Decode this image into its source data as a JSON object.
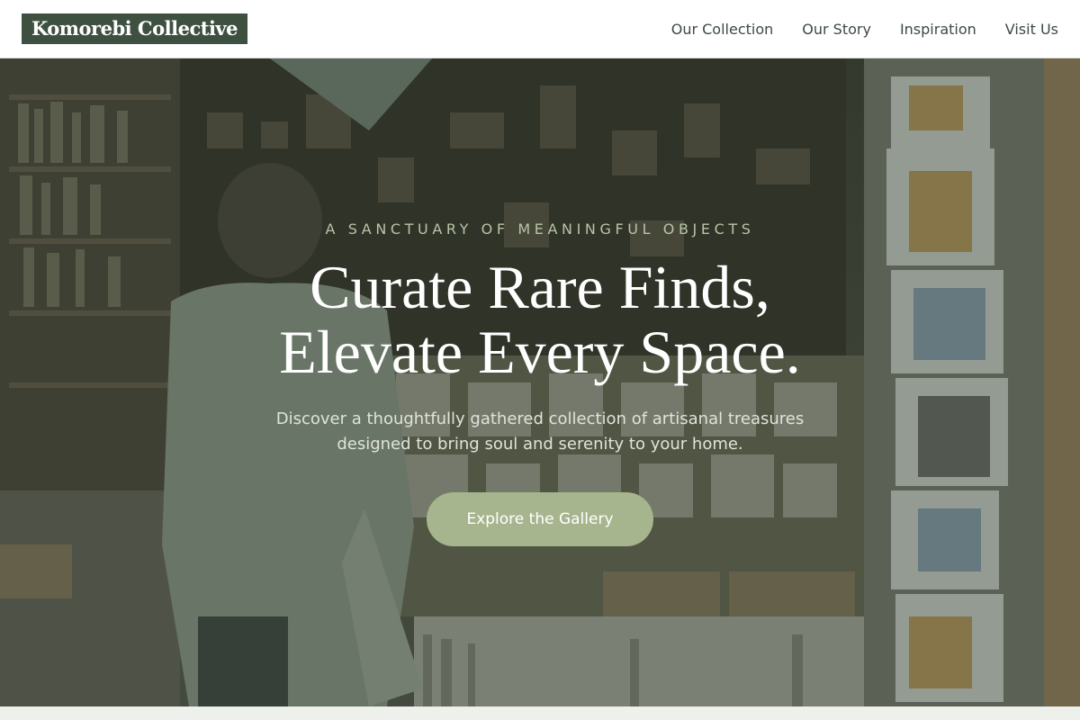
{
  "brand": {
    "name": "Komorebi Collective"
  },
  "nav": {
    "links": [
      {
        "label": "Our Collection"
      },
      {
        "label": "Our Story"
      },
      {
        "label": "Inspiration"
      },
      {
        "label": "Visit Us"
      }
    ]
  },
  "hero": {
    "kicker": "A SANCTUARY OF MEANINGFUL OBJECTS",
    "headline_line1": "Curate Rare Finds,",
    "headline_line2": "Elevate Every Space.",
    "subtitle_line1": "Discover a thoughtfully gathered collection of artisanal treasures",
    "subtitle_line2": "designed to bring soul and serenity to your home.",
    "cta_label": "Explore the Gallery"
  },
  "colors": {
    "brand": "#3e5141",
    "accent": "#a7b58e",
    "kicker": "#b7c4a6",
    "nav_text": "#3d4a40"
  }
}
